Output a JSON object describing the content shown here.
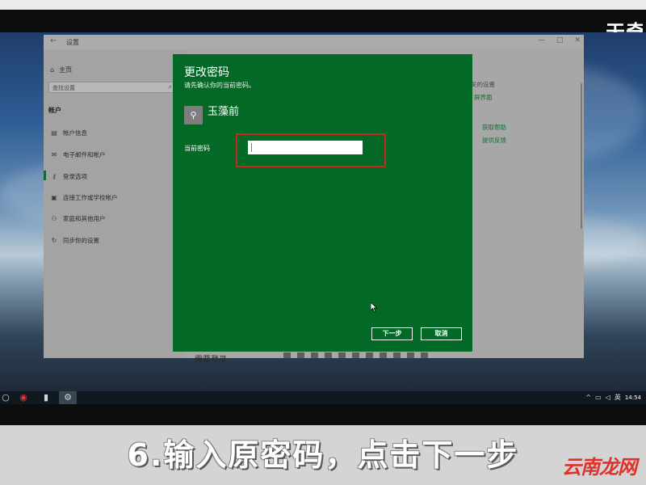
{
  "overlay": {
    "watermark_top": "天奇",
    "caption": "6.输入原密码，点击下一步",
    "watermark_bottom": "云南龙网"
  },
  "settings_window": {
    "title": "设置",
    "controls": [
      "—",
      "□",
      "✕"
    ],
    "sidebar": {
      "home": "主页",
      "search_placeholder": "查找设置",
      "section": "帐户",
      "items": [
        {
          "label": "帐户信息",
          "icon": "person-card-icon"
        },
        {
          "label": "电子邮件和帐户",
          "icon": "mail-icon"
        },
        {
          "label": "登录选项",
          "icon": "key-icon",
          "selected": true
        },
        {
          "label": "连接工作或学校帐户",
          "icon": "briefcase-icon"
        },
        {
          "label": "家庭和其他用户",
          "icon": "people-icon"
        },
        {
          "label": "同步你的设置",
          "icon": "sync-icon"
        }
      ]
    },
    "right_links": {
      "related_fragment": "关的设置",
      "lock_screen_fragment": "屏界面",
      "get_help": "获取帮助",
      "feedback": "提供反馈"
    },
    "under_text": "需要登录"
  },
  "dialog": {
    "title": "更改密码",
    "subtitle": "请先确认你的当前密码。",
    "user_name": "玉藻前",
    "field_label": "当前密码",
    "password_value": "",
    "next_label": "下一步",
    "cancel_label": "取消"
  },
  "taskbar": {
    "time": "14:54",
    "ime": "英"
  },
  "colors": {
    "dialog_green": "#046927",
    "highlight_red": "#c8281e"
  }
}
